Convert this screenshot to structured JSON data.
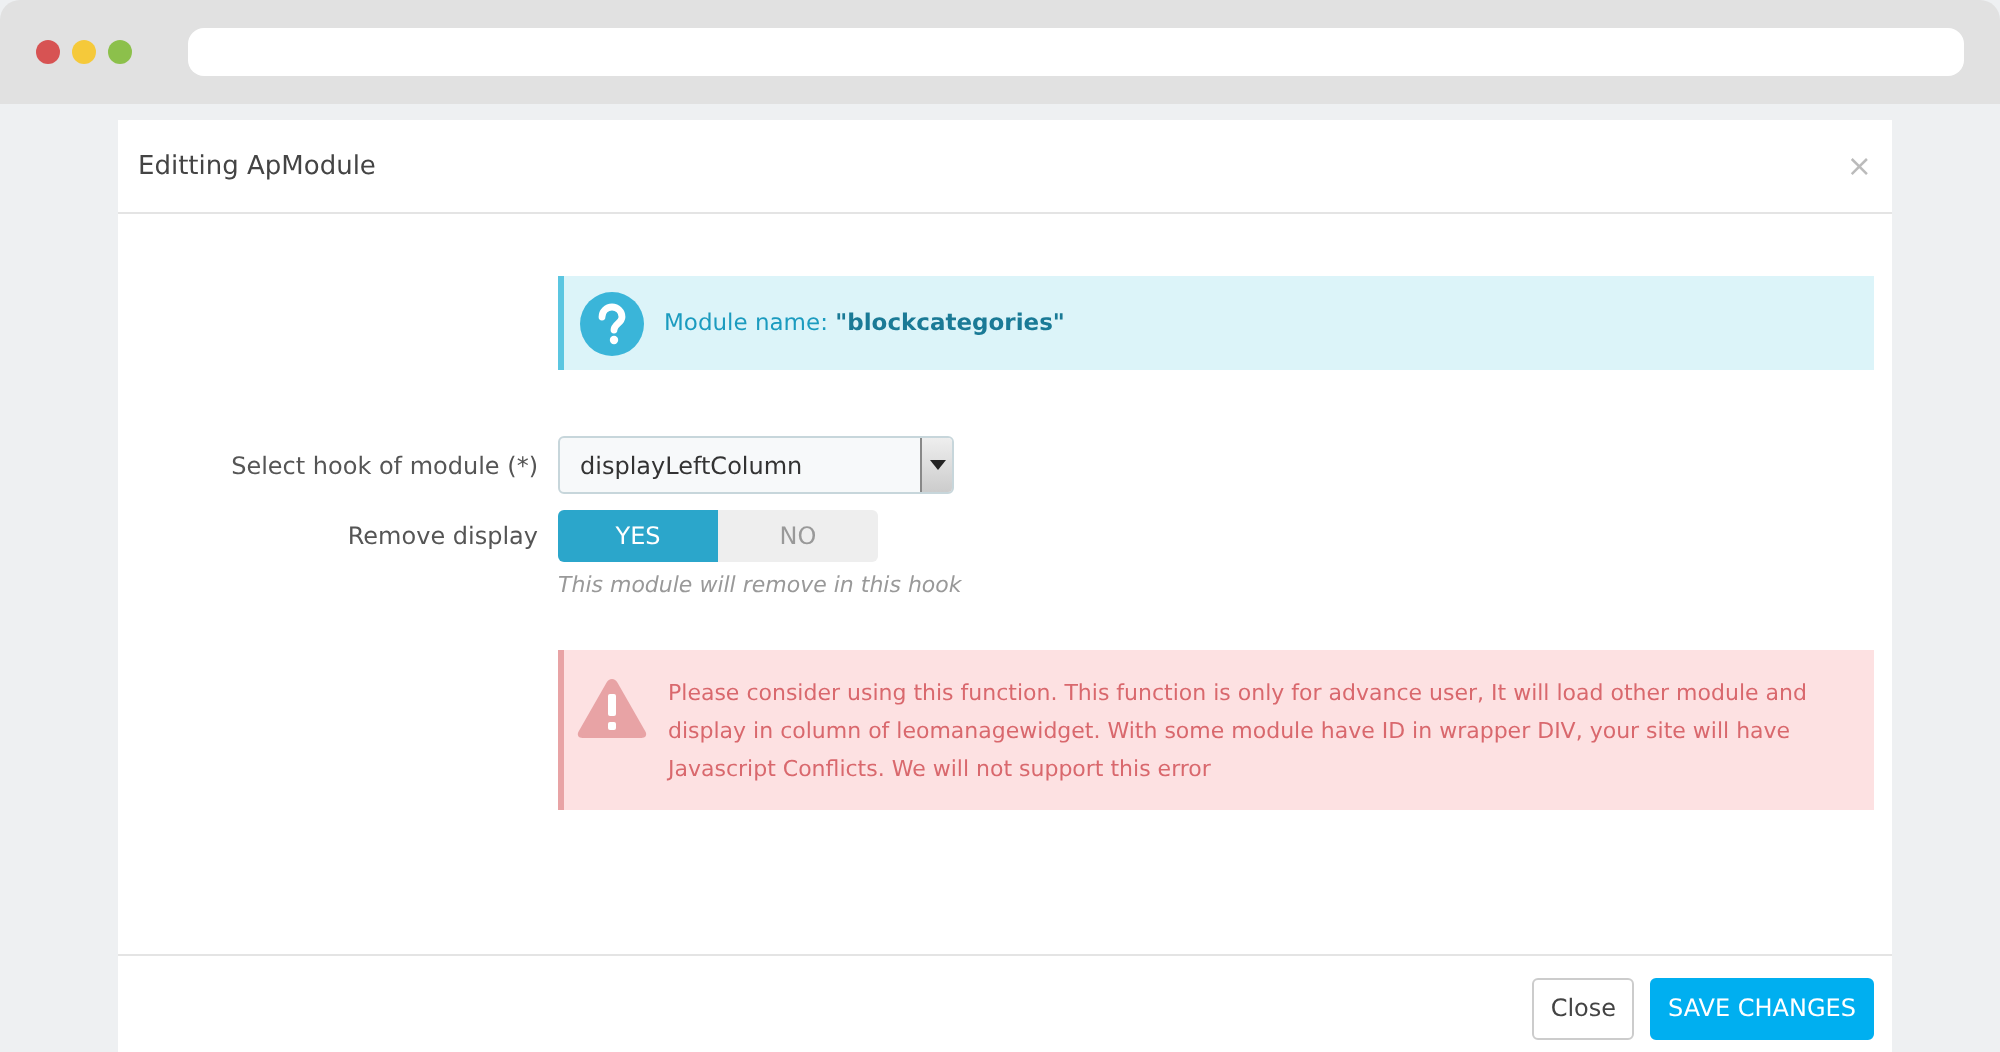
{
  "browser": {
    "dots": [
      {
        "color": "#d75353"
      },
      {
        "color": "#f5c93a"
      },
      {
        "color": "#8cc04b"
      }
    ]
  },
  "modal": {
    "title": "Editting ApModule",
    "close_glyph": "×"
  },
  "info_alert": {
    "text": "Module name: **\"blockcategories\"**"
  },
  "hook_field": {
    "label": "Select hook of module (*)",
    "value": "displayLeftColumn"
  },
  "remove_display": {
    "label": "Remove display",
    "options": [
      {
        "label": "YES",
        "selected": true
      },
      {
        "label": "NO",
        "selected": false
      }
    ],
    "help": "This module will remove in this hook"
  },
  "warning_alert": {
    "text": "Please consider using this function. This function is only for advance user, It will load other module and display in column of leomanagewidget. With some module have ID in wrapper DIV, your site will have Javascript Conflicts. We will not support this error"
  },
  "footer": {
    "buttons": [
      {
        "label": "Close",
        "kind": "default"
      },
      {
        "label": "SAVE CHANGES",
        "kind": "primary"
      }
    ]
  }
}
